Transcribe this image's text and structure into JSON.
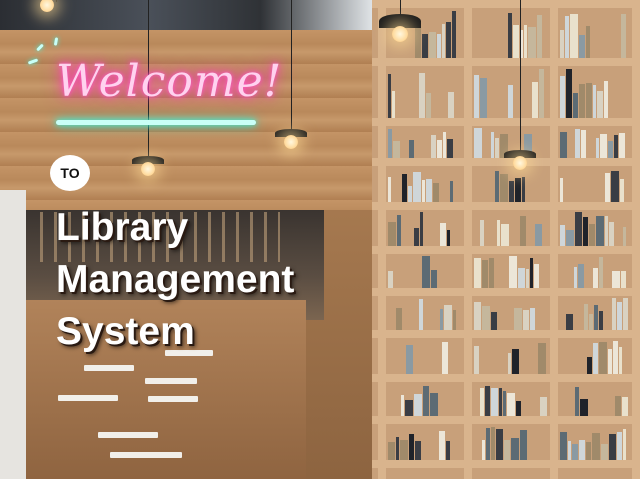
{
  "neon": {
    "text": "Welcome!"
  },
  "badge": {
    "text": "TO"
  },
  "title": {
    "lines": [
      "Library",
      "Management",
      "System"
    ]
  },
  "colors": {
    "neon_pink": "#ff3fb8",
    "neon_teal": "#3ff0d8",
    "wood": "#c8a07a"
  }
}
